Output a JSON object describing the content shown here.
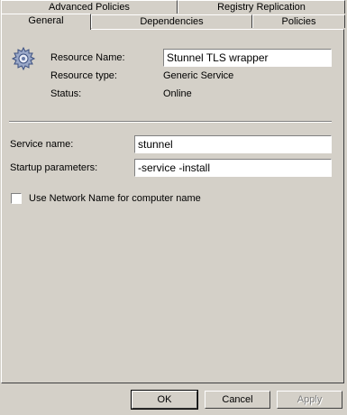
{
  "tabs_back": [
    "Advanced Policies",
    "Registry Replication"
  ],
  "tabs_front": [
    "General",
    "Dependencies",
    "Policies"
  ],
  "resource": {
    "icon": "gear-icon",
    "name_label": "Resource Name:",
    "name_value": "Stunnel TLS wrapper",
    "type_label": "Resource type:",
    "type_value": "Generic Service",
    "status_label": "Status:",
    "status_value": "Online"
  },
  "service": {
    "name_label": "Service name:",
    "name_value": "stunnel",
    "params_label": "Startup parameters:",
    "params_value": "-service -install",
    "checkbox_label": "Use Network Name for computer name",
    "checkbox_checked": false
  },
  "buttons": {
    "ok": "OK",
    "cancel": "Cancel",
    "apply": "Apply"
  }
}
